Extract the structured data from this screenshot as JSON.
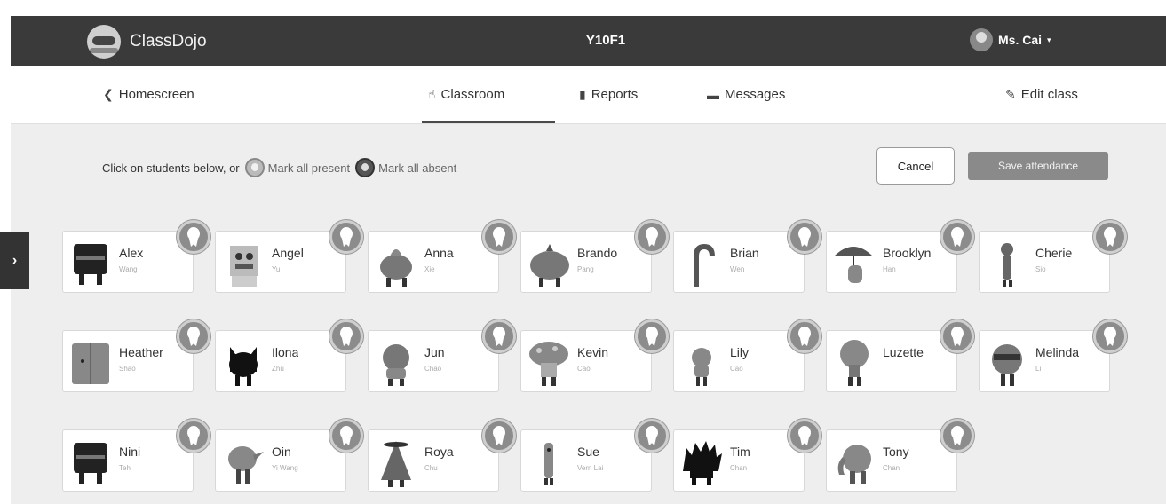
{
  "app": {
    "brand": "ClassDojo",
    "class_name": "Y10F1",
    "user": "Ms. Cai"
  },
  "nav": {
    "home": "Homescreen",
    "classroom": "Classroom",
    "reports": "Reports",
    "messages": "Messages",
    "edit": "Edit class",
    "active_tab": "Classroom"
  },
  "attendance": {
    "instruction": "Click on students below, or",
    "mark_present": "Mark all present",
    "mark_absent": "Mark all absent",
    "cancel": "Cancel",
    "save": "Save attendance"
  },
  "students": [
    {
      "first": "Alex",
      "last": "Wang",
      "shape": "block"
    },
    {
      "first": "Angel",
      "last": "Yu",
      "shape": "robot"
    },
    {
      "first": "Anna",
      "last": "Xie",
      "shape": "cone"
    },
    {
      "first": "Brando",
      "last": "Pang",
      "shape": "blob"
    },
    {
      "first": "Brian",
      "last": "Wen",
      "shape": "hook"
    },
    {
      "first": "Brooklyn",
      "last": "Han",
      "shape": "umbrella"
    },
    {
      "first": "Cherie",
      "last": "Sio",
      "shape": "thin"
    },
    {
      "first": "Heather",
      "last": "Shao",
      "shape": "book"
    },
    {
      "first": "Ilona",
      "last": "Zhu",
      "shape": "cat"
    },
    {
      "first": "Jun",
      "last": "Chao",
      "shape": "round"
    },
    {
      "first": "Kevin",
      "last": "Cao",
      "shape": "mushroom"
    },
    {
      "first": "Lily",
      "last": "Cao",
      "shape": "small"
    },
    {
      "first": "Luzette",
      "last": "",
      "shape": "tree"
    },
    {
      "first": "Melinda",
      "last": "Li",
      "shape": "ninja"
    },
    {
      "first": "Nini",
      "last": "Teh",
      "shape": "block"
    },
    {
      "first": "Oin",
      "last": "Yi Wang",
      "shape": "bird"
    },
    {
      "first": "Roya",
      "last": "Chu",
      "shape": "witch"
    },
    {
      "first": "Sue",
      "last": "Vern Lai",
      "shape": "stick"
    },
    {
      "first": "Tim",
      "last": "Chan",
      "shape": "spiky"
    },
    {
      "first": "Tony",
      "last": "Chan",
      "shape": "elephant"
    }
  ]
}
